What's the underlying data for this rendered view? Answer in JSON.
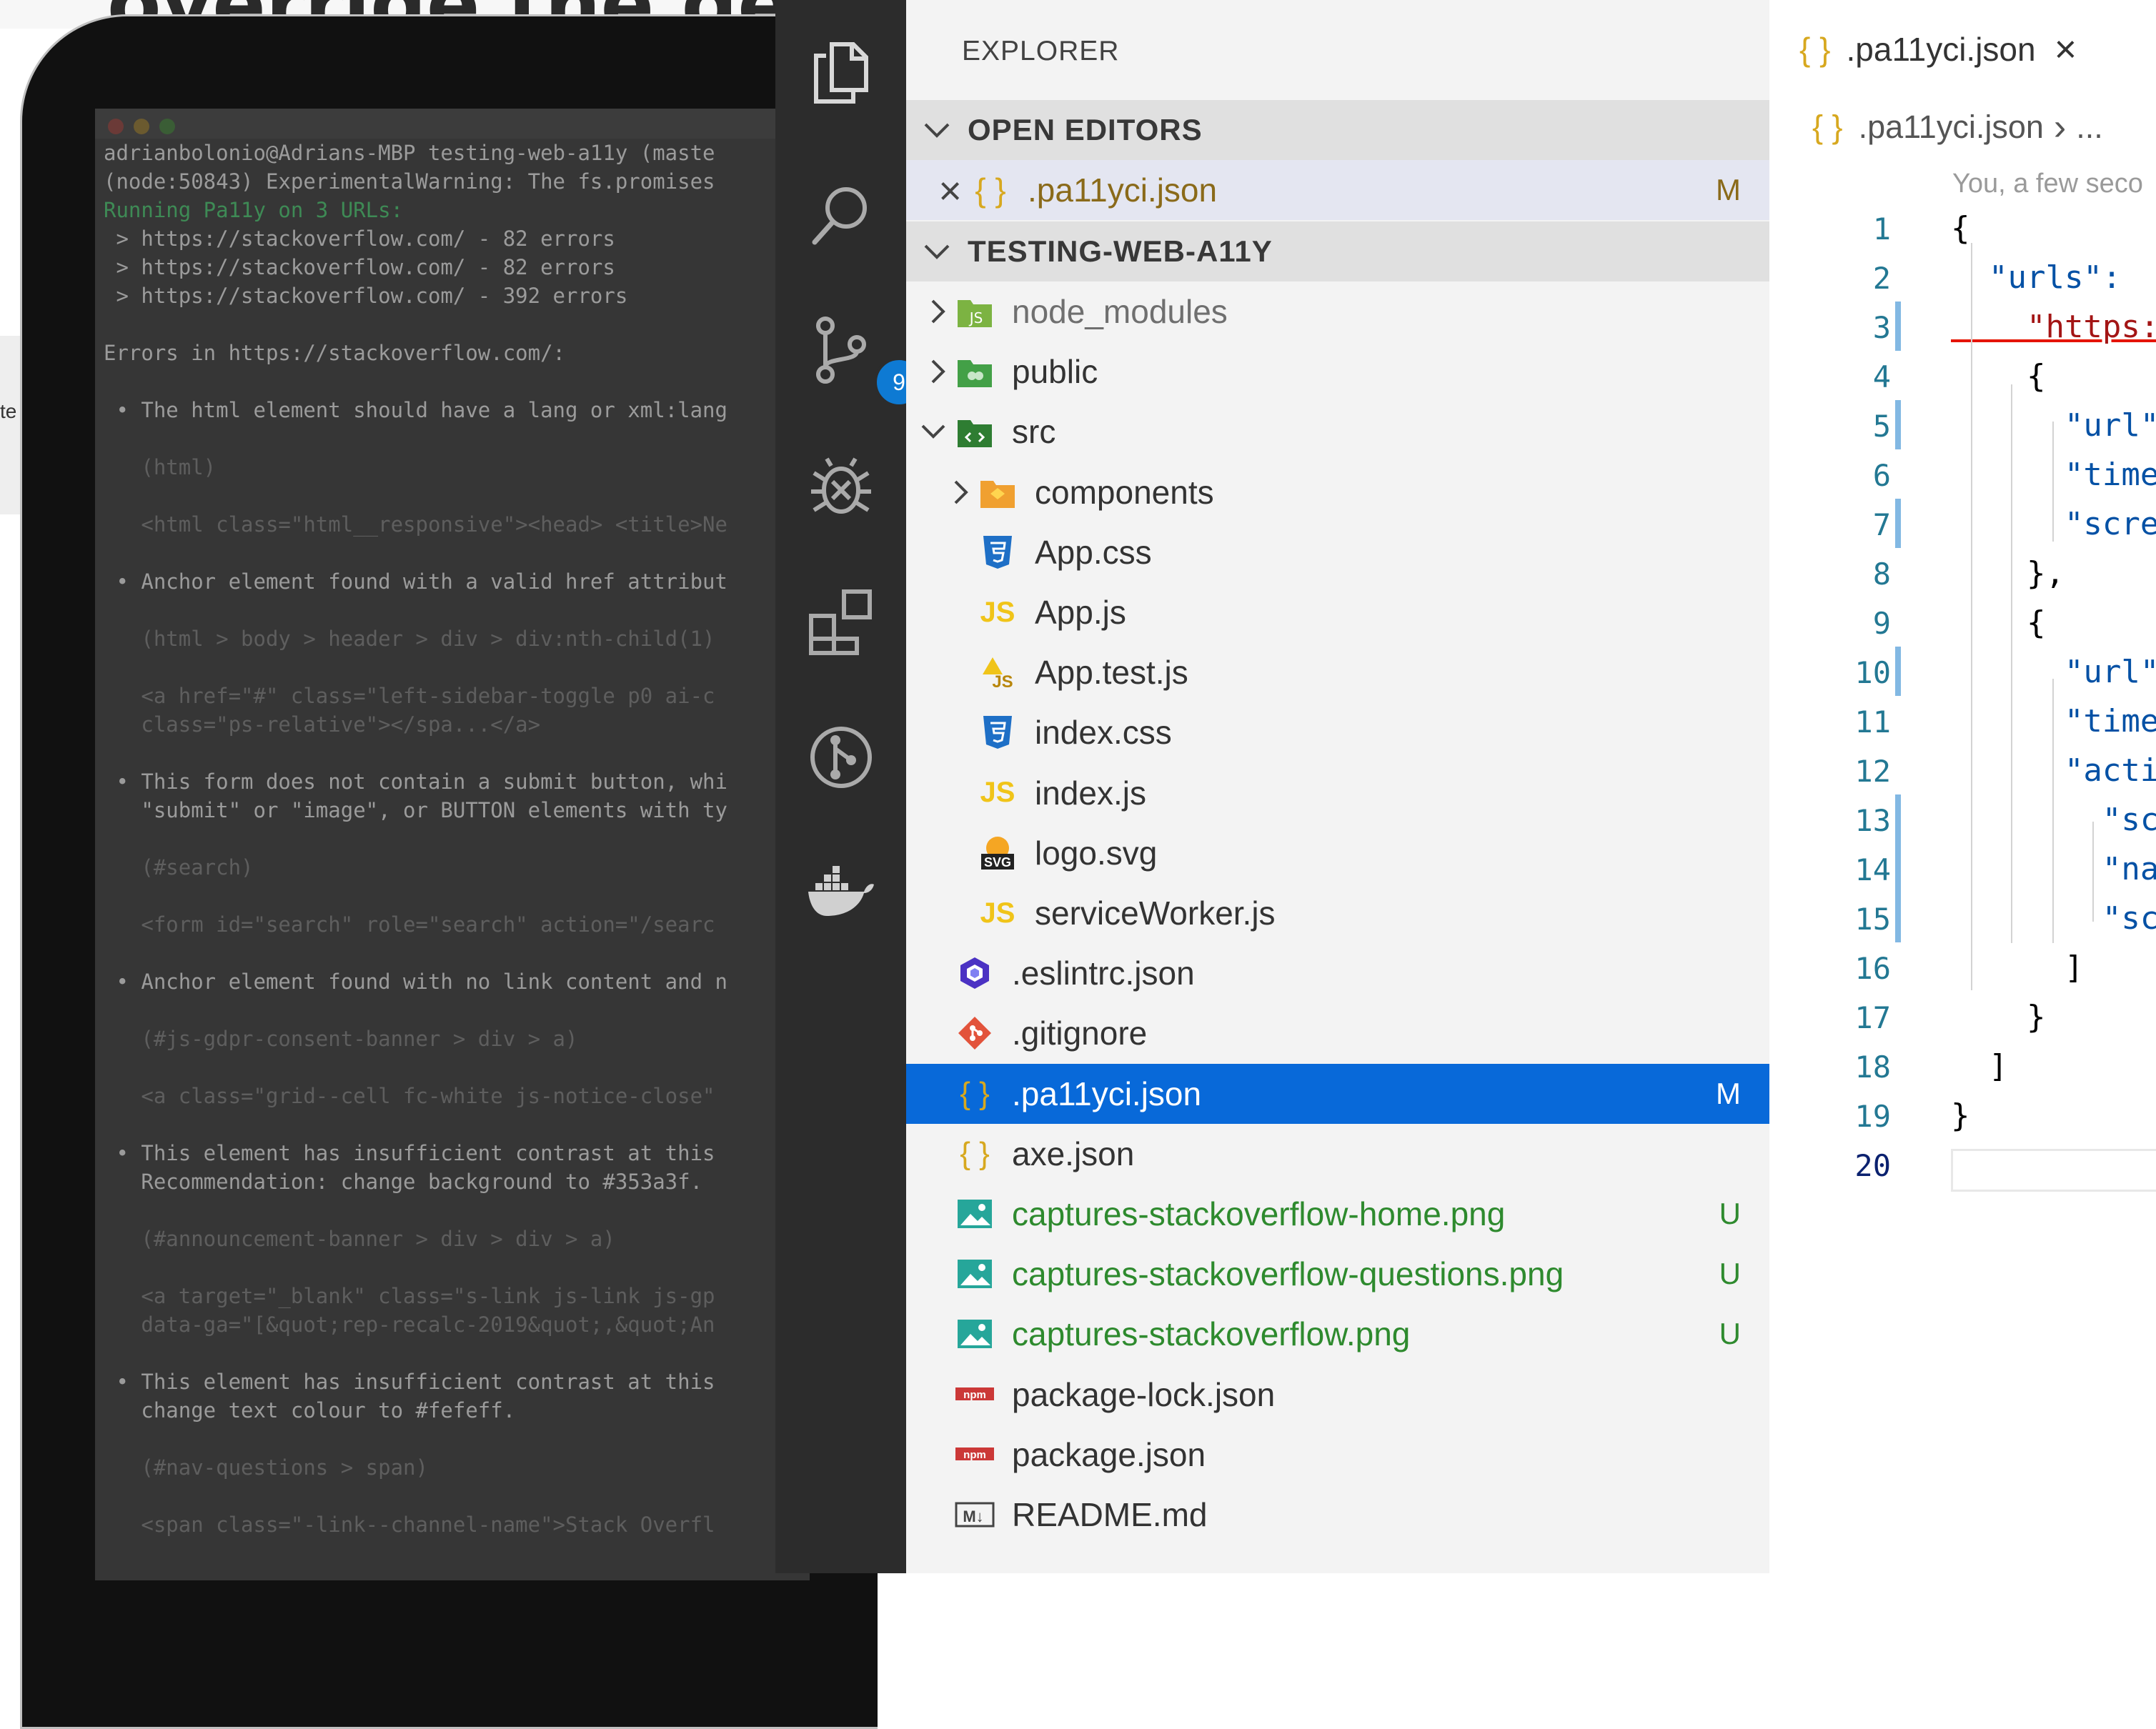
{
  "colors": {
    "accent": "#0869d9",
    "added": "#2e8a2e",
    "modified": "#8a6a1a",
    "badge": "#0e7ad3"
  },
  "background": {
    "heading": "override the defaults too.",
    "side_label": "te"
  },
  "terminal": {
    "lines": [
      {
        "text": "adrianbolonio@Adrians-MBP testing-web-a11y (maste",
        "cls": "c-norm"
      },
      {
        "text": "(node:50843) ExperimentalWarning: The fs.promises",
        "cls": "c-norm"
      },
      {
        "text": "Running Pa11y on 3 URLs:",
        "cls": "c-green"
      },
      {
        "text": " > https://stackoverflow.com/ - 82 errors",
        "cls": "c-norm"
      },
      {
        "text": " > https://stackoverflow.com/ - 82 errors",
        "cls": "c-norm"
      },
      {
        "text": " > https://stackoverflow.com/ - 392 errors",
        "cls": "c-norm"
      },
      {
        "text": "",
        "cls": "c-norm"
      },
      {
        "text": "Errors in https://stackoverflow.com/:",
        "cls": "c-norm"
      },
      {
        "text": "",
        "cls": "c-norm"
      },
      {
        "text": " • The html element should have a lang or xml:lang",
        "cls": "c-norm"
      },
      {
        "text": "",
        "cls": "c-norm"
      },
      {
        "text": "   (html)",
        "cls": "c-dim"
      },
      {
        "text": "",
        "cls": "c-norm"
      },
      {
        "text": "   <html class=\"html__responsive\"><head> <title>Ne",
        "cls": "c-dim"
      },
      {
        "text": "",
        "cls": "c-norm"
      },
      {
        "text": " • Anchor element found with a valid href attribut",
        "cls": "c-norm"
      },
      {
        "text": "",
        "cls": "c-norm"
      },
      {
        "text": "   (html > body > header > div > div:nth-child(1)",
        "cls": "c-dim"
      },
      {
        "text": "",
        "cls": "c-norm"
      },
      {
        "text": "   <a href=\"#\" class=\"left-sidebar-toggle p0 ai-c",
        "cls": "c-dim"
      },
      {
        "text": "   class=\"ps-relative\"></spa...</a>",
        "cls": "c-dim"
      },
      {
        "text": "",
        "cls": "c-norm"
      },
      {
        "text": " • This form does not contain a submit button, whi",
        "cls": "c-norm"
      },
      {
        "text": "   \"submit\" or \"image\", or BUTTON elements with ty",
        "cls": "c-norm"
      },
      {
        "text": "",
        "cls": "c-norm"
      },
      {
        "text": "   (#search)",
        "cls": "c-dim"
      },
      {
        "text": "",
        "cls": "c-norm"
      },
      {
        "text": "   <form id=\"search\" role=\"search\" action=\"/searc",
        "cls": "c-dim"
      },
      {
        "text": "",
        "cls": "c-norm"
      },
      {
        "text": " • Anchor element found with no link content and n",
        "cls": "c-norm"
      },
      {
        "text": "",
        "cls": "c-norm"
      },
      {
        "text": "   (#js-gdpr-consent-banner > div > a)",
        "cls": "c-dim"
      },
      {
        "text": "",
        "cls": "c-norm"
      },
      {
        "text": "   <a class=\"grid--cell fc-white js-notice-close\"",
        "cls": "c-dim"
      },
      {
        "text": "",
        "cls": "c-norm"
      },
      {
        "text": " • This element has insufficient contrast at this",
        "cls": "c-norm"
      },
      {
        "text": "   Recommendation: change background to #353a3f.",
        "cls": "c-norm"
      },
      {
        "text": "",
        "cls": "c-norm"
      },
      {
        "text": "   (#announcement-banner > div > div > a)",
        "cls": "c-dim"
      },
      {
        "text": "",
        "cls": "c-norm"
      },
      {
        "text": "   <a target=\"_blank\" class=\"s-link js-link js-gp",
        "cls": "c-dim"
      },
      {
        "text": "   data-ga=\"[&quot;rep-recalc-2019&quot;,&quot;An",
        "cls": "c-dim"
      },
      {
        "text": "",
        "cls": "c-norm"
      },
      {
        "text": " • This element has insufficient contrast at this",
        "cls": "c-norm"
      },
      {
        "text": "   change text colour to #fefeff.",
        "cls": "c-norm"
      },
      {
        "text": "",
        "cls": "c-norm"
      },
      {
        "text": "   (#nav-questions > span)",
        "cls": "c-dim"
      },
      {
        "text": "",
        "cls": "c-norm"
      },
      {
        "text": "   <span class=\"-link--channel-name\">Stack Overfl",
        "cls": "c-dim"
      }
    ]
  },
  "activity_bar": {
    "source_control_badge": "9",
    "icons": [
      "files-icon",
      "search-icon",
      "source-control-icon",
      "debug-icon",
      "extensions-icon",
      "git-graph-icon",
      "docker-icon"
    ]
  },
  "explorer": {
    "title": "EXPLORER",
    "open_editors_label": "OPEN EDITORS",
    "open_editor": {
      "close": "×",
      "icon": "{ }",
      "name": ".pa11yci.json",
      "status": "M"
    },
    "project_label": "TESTING-WEB-A11Y",
    "tree": [
      {
        "name": "node_modules",
        "icon": "node",
        "arrow": "›",
        "indent": 0,
        "color": "#6f6f6f",
        "status": ""
      },
      {
        "name": "public",
        "icon": "folder-green",
        "arrow": "›",
        "indent": 0,
        "color": "#333333",
        "status": ""
      },
      {
        "name": "src",
        "icon": "folder-src",
        "arrow": "⌄",
        "indent": 0,
        "color": "#333333",
        "status": ""
      },
      {
        "name": "components",
        "icon": "folder-orange",
        "arrow": "›",
        "indent": 1,
        "color": "#333333",
        "status": ""
      },
      {
        "name": "App.css",
        "icon": "css",
        "arrow": "",
        "indent": 1,
        "color": "#333333",
        "status": ""
      },
      {
        "name": "App.js",
        "icon": "js",
        "arrow": "",
        "indent": 1,
        "color": "#333333",
        "status": ""
      },
      {
        "name": "App.test.js",
        "icon": "jstest",
        "arrow": "",
        "indent": 1,
        "color": "#333333",
        "status": ""
      },
      {
        "name": "index.css",
        "icon": "css",
        "arrow": "",
        "indent": 1,
        "color": "#333333",
        "status": ""
      },
      {
        "name": "index.js",
        "icon": "js",
        "arrow": "",
        "indent": 1,
        "color": "#333333",
        "status": ""
      },
      {
        "name": "logo.svg",
        "icon": "svg",
        "arrow": "",
        "indent": 1,
        "color": "#333333",
        "status": ""
      },
      {
        "name": "serviceWorker.js",
        "icon": "js",
        "arrow": "",
        "indent": 1,
        "color": "#333333",
        "status": ""
      },
      {
        "name": ".eslintrc.json",
        "icon": "eslint",
        "arrow": "",
        "indent": 0,
        "color": "#333333",
        "status": ""
      },
      {
        "name": ".gitignore",
        "icon": "git",
        "arrow": "",
        "indent": 0,
        "color": "#333333",
        "status": ""
      },
      {
        "name": ".pa11yci.json",
        "icon": "json",
        "arrow": "",
        "indent": 0,
        "color": "#ffffff",
        "status": "M",
        "selected": true
      },
      {
        "name": "axe.json",
        "icon": "json",
        "arrow": "",
        "indent": 0,
        "color": "#333333",
        "status": ""
      },
      {
        "name": "captures-stackoverflow-home.png",
        "icon": "image",
        "arrow": "",
        "indent": 0,
        "color": "#2e8a2e",
        "status": "U"
      },
      {
        "name": "captures-stackoverflow-questions.png",
        "icon": "image",
        "arrow": "",
        "indent": 0,
        "color": "#2e8a2e",
        "status": "U"
      },
      {
        "name": "captures-stackoverflow.png",
        "icon": "image",
        "arrow": "",
        "indent": 0,
        "color": "#2e8a2e",
        "status": "U"
      },
      {
        "name": "package-lock.json",
        "icon": "npm",
        "arrow": "",
        "indent": 0,
        "color": "#333333",
        "status": ""
      },
      {
        "name": "package.json",
        "icon": "npm",
        "arrow": "",
        "indent": 0,
        "color": "#333333",
        "status": ""
      },
      {
        "name": "README.md",
        "icon": "markdown",
        "arrow": "",
        "indent": 0,
        "color": "#333333",
        "status": ""
      }
    ]
  },
  "editor": {
    "tab_icon": "{ }",
    "tab_title": ".pa11yci.json",
    "tab_close": "×",
    "breadcrumb_icon": "{ }",
    "breadcrumb_file": ".pa11yci.json",
    "breadcrumb_sep": "›",
    "breadcrumb_more": "...",
    "blame": "You, a few seco",
    "lines": [
      {
        "n": "1",
        "code": "{"
      },
      {
        "n": "2",
        "code": "  \"urls\": "
      },
      {
        "n": "3",
        "code": "    \"https:"
      },
      {
        "n": "4",
        "code": "    {"
      },
      {
        "n": "5",
        "code": "      \"url\""
      },
      {
        "n": "6",
        "code": "      \"time"
      },
      {
        "n": "7",
        "code": "      \"scre"
      },
      {
        "n": "8",
        "code": "    },"
      },
      {
        "n": "9",
        "code": "    {"
      },
      {
        "n": "10",
        "code": "      \"url\""
      },
      {
        "n": "11",
        "code": "      \"time"
      },
      {
        "n": "12",
        "code": "      \"acti"
      },
      {
        "n": "13",
        "code": "        \"sc"
      },
      {
        "n": "14",
        "code": "        \"na"
      },
      {
        "n": "15",
        "code": "        \"sc"
      },
      {
        "n": "16",
        "code": "      ]"
      },
      {
        "n": "17",
        "code": "    }"
      },
      {
        "n": "18",
        "code": "  ]"
      },
      {
        "n": "19",
        "code": "}"
      },
      {
        "n": "20",
        "code": ""
      }
    ]
  }
}
